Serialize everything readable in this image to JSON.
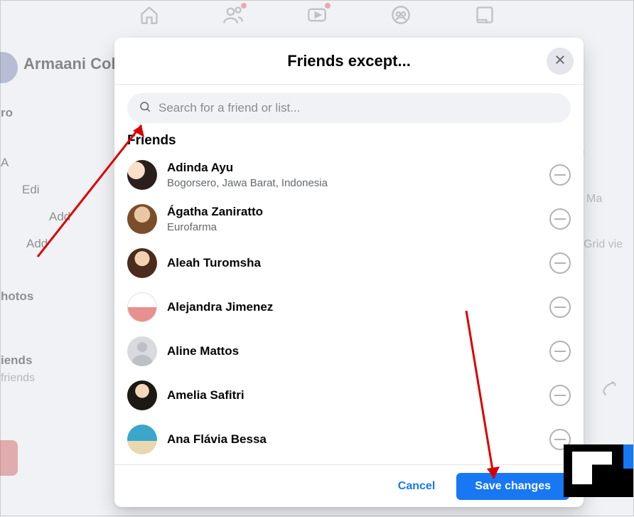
{
  "background": {
    "username": "Armaani Col",
    "side": {
      "intro": "ro",
      "edit": "Edi",
      "add1": "Add",
      "add2": "Add",
      "photos": "hotos",
      "friends": "iends",
      "friends_sub": " friends"
    },
    "right": {
      "make": "Ma",
      "grid": "Grid vie"
    }
  },
  "modal": {
    "title": "Friends except...",
    "search_placeholder": "Search for a friend or list...",
    "section_heading": "Friends",
    "cancel_label": "Cancel",
    "save_label": "Save changes",
    "items": [
      {
        "name": "Adinda Ayu",
        "sub": "Bogorsero, Jawa Barat, Indonesia"
      },
      {
        "name": "Ágatha Zaniratto",
        "sub": "Eurofarma"
      },
      {
        "name": "Aleah Turomsha",
        "sub": ""
      },
      {
        "name": "Alejandra Jimenez",
        "sub": ""
      },
      {
        "name": "Aline Mattos",
        "sub": ""
      },
      {
        "name": "Amelia Safitri",
        "sub": ""
      },
      {
        "name": "Ana Flávia Bessa",
        "sub": ""
      }
    ]
  }
}
